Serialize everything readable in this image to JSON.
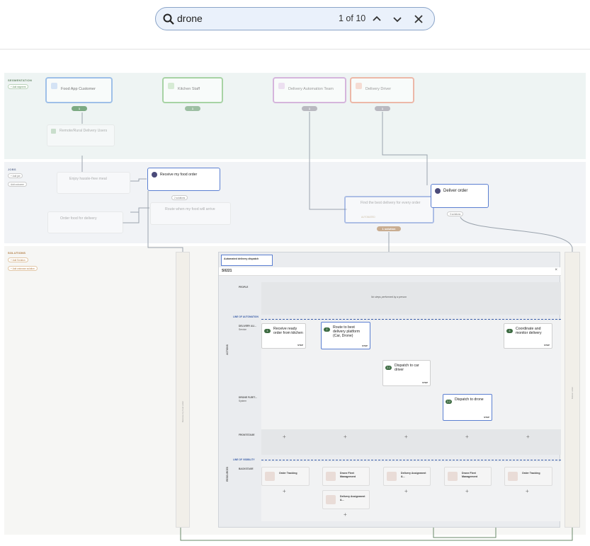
{
  "search": {
    "query": "drone",
    "count": "1 of 10"
  },
  "colors": {
    "accent": "#8aa4c8",
    "green": "#3d6b42",
    "blue_border": "#5b7fd1"
  },
  "sections": {
    "segmentation": "SEGMENTATION",
    "add_segment": "+ Add segment",
    "jobs": "JOBS",
    "add_job": "+ Add job",
    "add_outcome": "Add outcome",
    "solutions": "SOLUTIONS",
    "add_solution": "+ Add Solution",
    "add_unknown": "+ Add unknown solution"
  },
  "personas": [
    {
      "name": "Food App Customer",
      "chip": "1"
    },
    {
      "name": "Kitchen Staff",
      "chip": "1"
    },
    {
      "name": "Delivery Automation Team",
      "chip": "1"
    },
    {
      "name": "Delivery Driver",
      "chip": "1"
    }
  ],
  "subsegment": {
    "name": "Remote/Rural Delivery Users"
  },
  "jobs": {
    "enjoy": "Enjoy hassle-free meal",
    "receive": "Receive my food order",
    "order": "Order food for delivery",
    "route": "Route when my food will arrive",
    "find": "Find the best delivery for every order",
    "deliver": "Deliver order",
    "automated": "AUTOMATED",
    "two_solutions": "2 solutions",
    "one_solution": "1 solution",
    "three_solutions": "3 solutions"
  },
  "panel": {
    "title": "Automated delivery dispatch",
    "id": "S0221",
    "rows": {
      "people": "PEOPLE",
      "no_steps": "No steps performed by a person",
      "line_automation": "LINE OF AUTOMATION",
      "delivery_auto": "DELIVERY AU...",
      "delivery_auto_sub": "Service",
      "drone_fleet": "DRONE FLEET...",
      "drone_fleet_sub": "System",
      "frontstage": "FRONTSTAGE",
      "line_visibility": "LINE OF VISIBILITY",
      "backstage": "BACKSTAGE",
      "actions": "ACTIONS",
      "resources": "RESOURCES"
    },
    "steps": [
      {
        "n": "1",
        "text": "Receive ready order from kitchen",
        "foot": "STEP"
      },
      {
        "n": "2",
        "text": "Route to best delivery platform (Car, Drone)",
        "foot": "STEP"
      },
      {
        "n": "3",
        "text": "Coordinate and monitor delivery",
        "foot": "STEP"
      },
      {
        "n": "2.1",
        "text": "Dispatch to car driver",
        "foot": "STEP"
      },
      {
        "n": "2.2",
        "text": "Dispatch to drone",
        "foot": "STEP"
      }
    ],
    "systems": [
      "Order Tracking",
      "Drone Fleet Management",
      "Delivery Assignment &...",
      "Drone Fleet Management",
      "Order Tracking",
      "Delivery Assignment &..."
    ],
    "side_left": "Receive my food order",
    "side_right": "Deliver order"
  }
}
